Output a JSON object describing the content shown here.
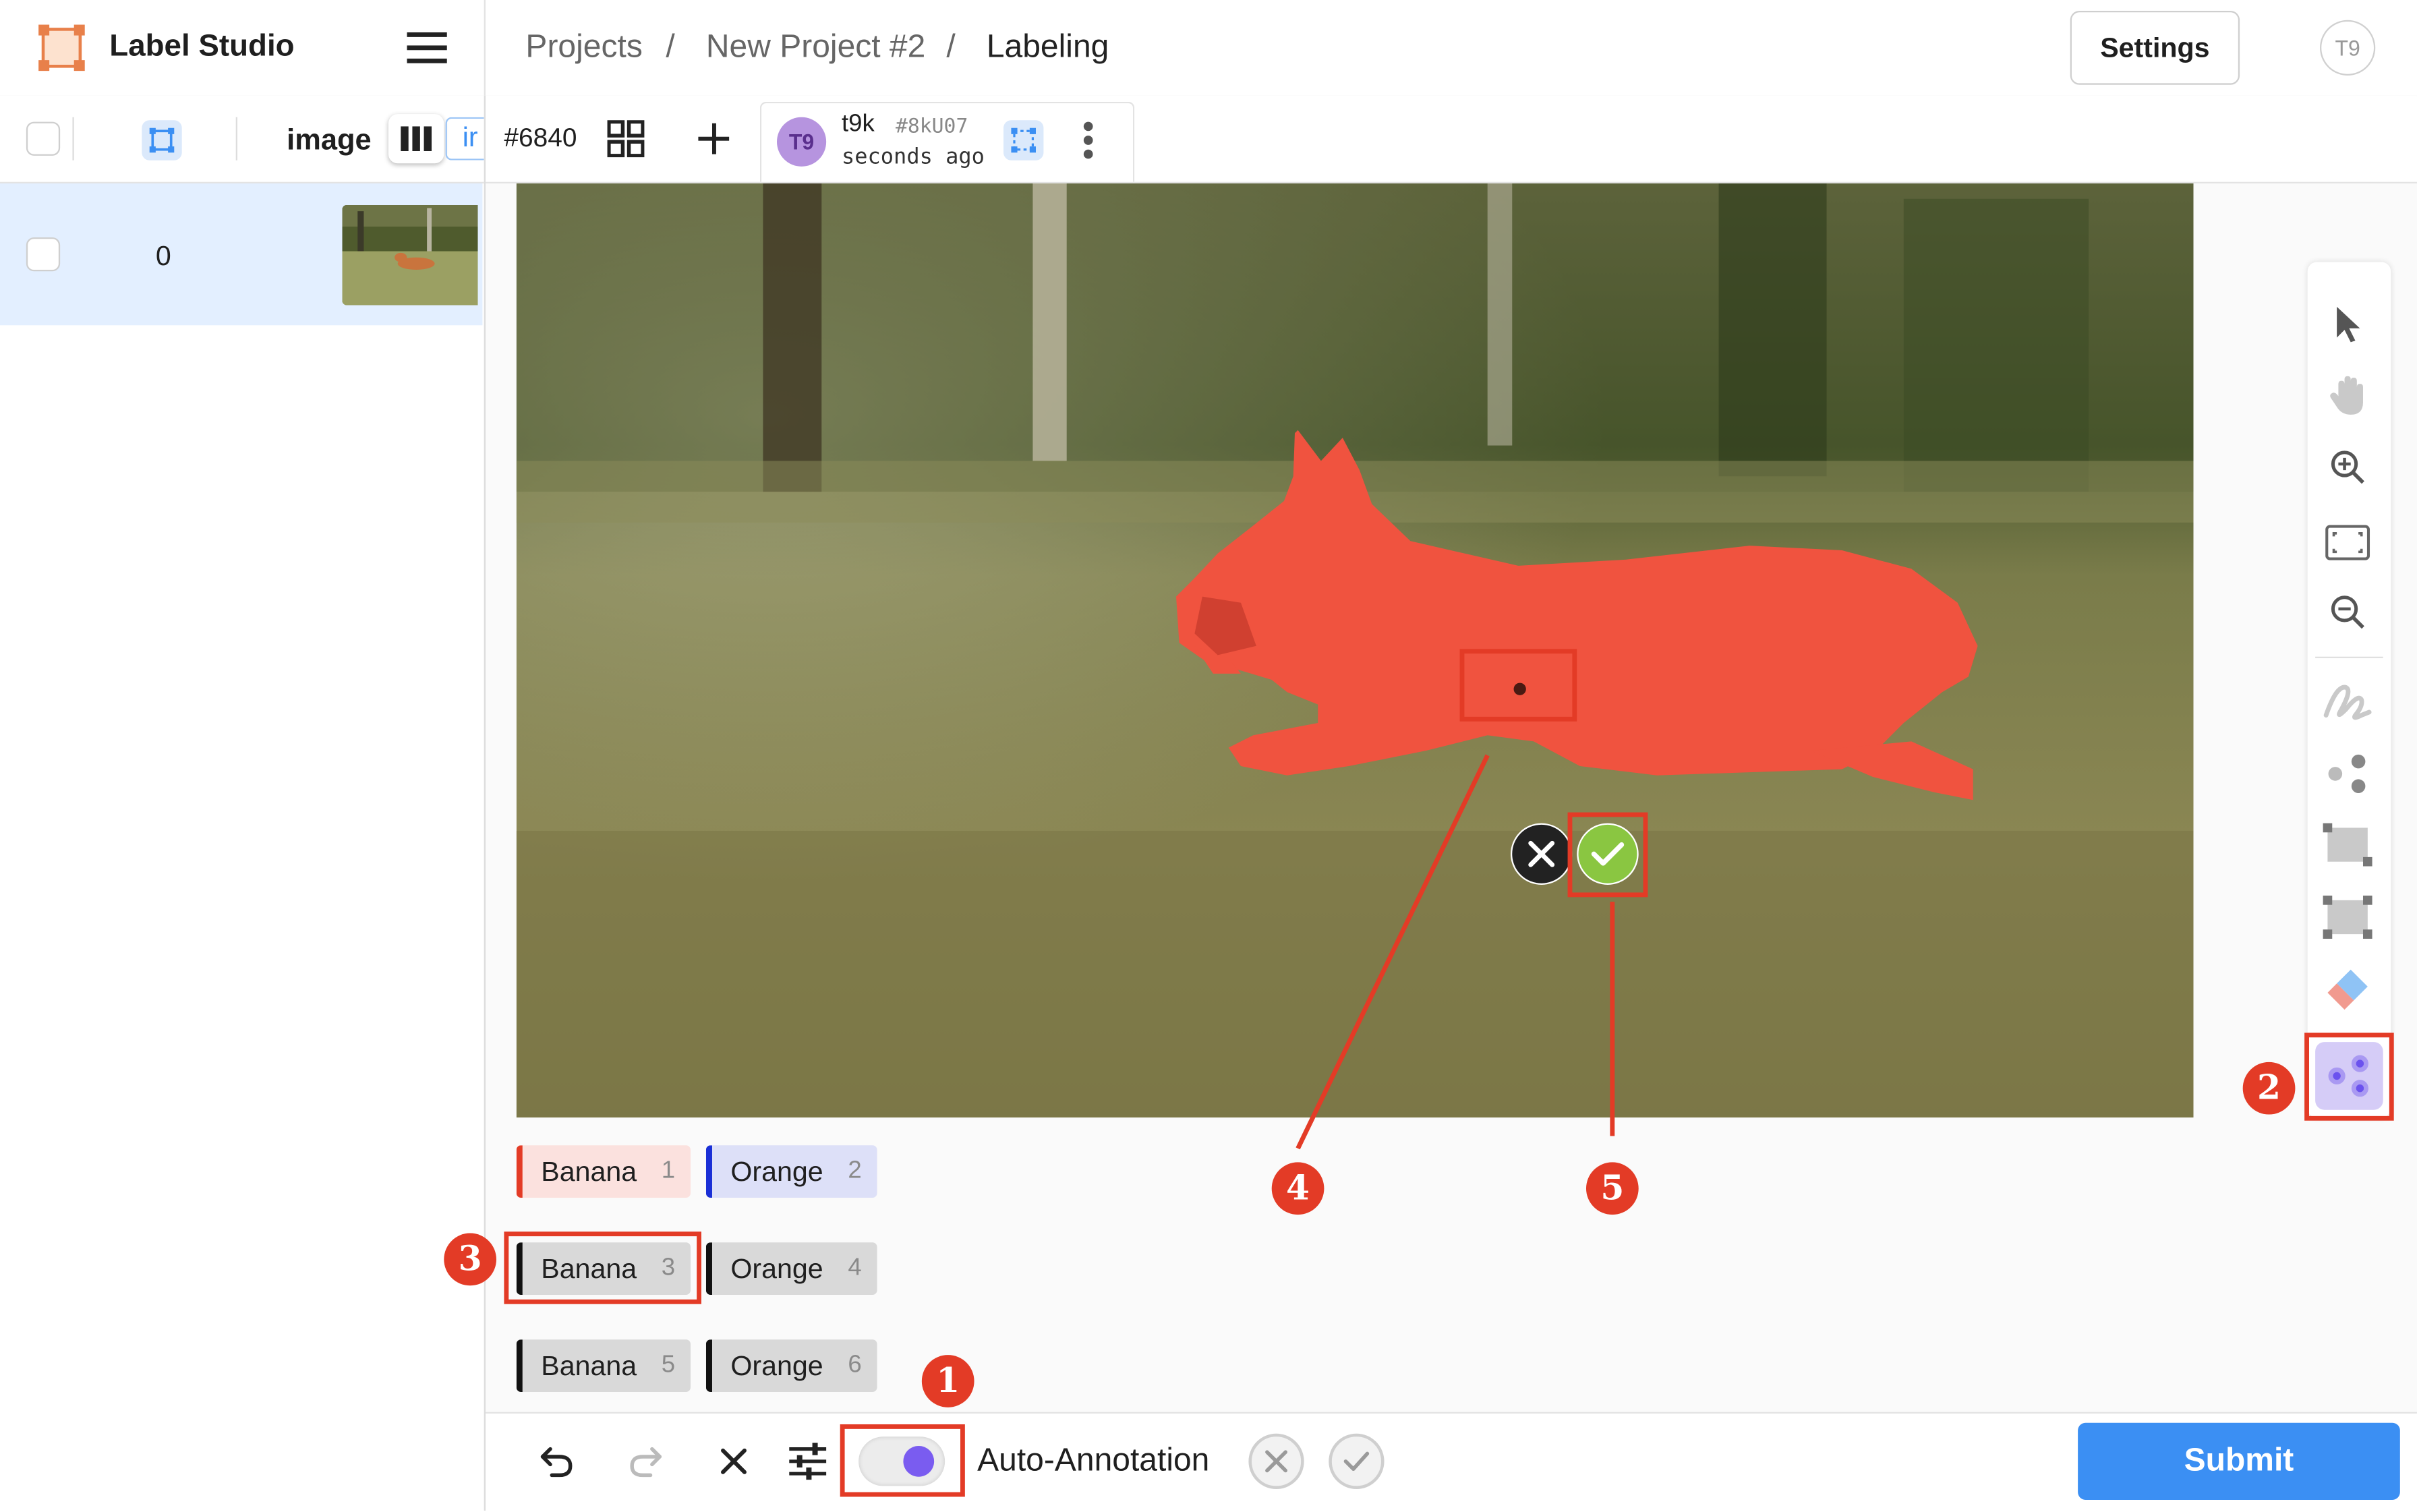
{
  "app": {
    "name": "Label Studio"
  },
  "breadcrumb": {
    "projects": "Projects",
    "sep1": "/",
    "project": "New Project #2",
    "sep2": "/",
    "current": "Labeling"
  },
  "header": {
    "settings_label": "Settings",
    "user_initials": "T9"
  },
  "sidebar": {
    "column_image": "image",
    "column_partial": "ir",
    "rows": [
      {
        "id": "0"
      }
    ]
  },
  "annotation_tabs": {
    "task_id": "#6840",
    "user_initials": "T9",
    "user_name": "t9k",
    "annotation_id": "#8kU07",
    "time": "seconds ago"
  },
  "labels": [
    {
      "text": "Banana",
      "hotkey": "1",
      "color": "#e33b26",
      "bg": "#fbe1de"
    },
    {
      "text": "Orange",
      "hotkey": "2",
      "color": "#1a2fd6",
      "bg": "#dde0f8"
    },
    {
      "text": "Banana",
      "hotkey": "3",
      "color": "#111111",
      "bg": "#d9d9d9"
    },
    {
      "text": "Orange",
      "hotkey": "4",
      "color": "#111111",
      "bg": "#d9d9d9"
    },
    {
      "text": "Banana",
      "hotkey": "5",
      "color": "#111111",
      "bg": "#d9d9d9"
    },
    {
      "text": "Orange",
      "hotkey": "6",
      "color": "#111111",
      "bg": "#d9d9d9"
    }
  ],
  "bottombar": {
    "auto_annotation_label": "Auto-Annotation",
    "submit_label": "Submit"
  },
  "callouts": {
    "one": "1",
    "two": "2",
    "three": "3",
    "four": "4",
    "five": "5"
  },
  "colors": {
    "accent": "#3b8ff3",
    "highlight": "#e33b26",
    "purple": "#7a5cf0",
    "mask": "#f05a45"
  }
}
